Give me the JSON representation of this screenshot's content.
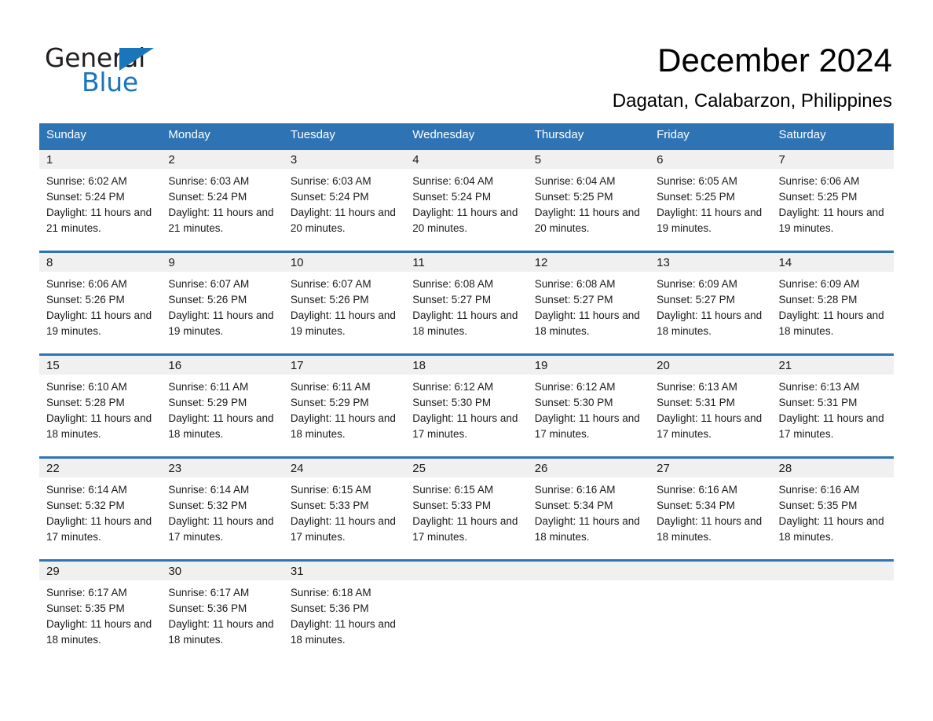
{
  "brand": {
    "name_part1": "General",
    "name_part2": "Blue",
    "logo_icon": "general-blue-triangle-logo",
    "accent_color": "#1b75bb"
  },
  "header": {
    "month_title": "December 2024",
    "location": "Dagatan, Calabarzon, Philippines"
  },
  "colors": {
    "header_blue": "#2e74b5",
    "day_band_gray": "#f0f0f0",
    "text": "#1a1a1a"
  },
  "calendar": {
    "day_headers": [
      "Sunday",
      "Monday",
      "Tuesday",
      "Wednesday",
      "Thursday",
      "Friday",
      "Saturday"
    ],
    "weeks": [
      [
        {
          "day": "1",
          "sunrise": "Sunrise: 6:02 AM",
          "sunset": "Sunset: 5:24 PM",
          "daylight": "Daylight: 11 hours and 21 minutes."
        },
        {
          "day": "2",
          "sunrise": "Sunrise: 6:03 AM",
          "sunset": "Sunset: 5:24 PM",
          "daylight": "Daylight: 11 hours and 21 minutes."
        },
        {
          "day": "3",
          "sunrise": "Sunrise: 6:03 AM",
          "sunset": "Sunset: 5:24 PM",
          "daylight": "Daylight: 11 hours and 20 minutes."
        },
        {
          "day": "4",
          "sunrise": "Sunrise: 6:04 AM",
          "sunset": "Sunset: 5:24 PM",
          "daylight": "Daylight: 11 hours and 20 minutes."
        },
        {
          "day": "5",
          "sunrise": "Sunrise: 6:04 AM",
          "sunset": "Sunset: 5:25 PM",
          "daylight": "Daylight: 11 hours and 20 minutes."
        },
        {
          "day": "6",
          "sunrise": "Sunrise: 6:05 AM",
          "sunset": "Sunset: 5:25 PM",
          "daylight": "Daylight: 11 hours and 19 minutes."
        },
        {
          "day": "7",
          "sunrise": "Sunrise: 6:06 AM",
          "sunset": "Sunset: 5:25 PM",
          "daylight": "Daylight: 11 hours and 19 minutes."
        }
      ],
      [
        {
          "day": "8",
          "sunrise": "Sunrise: 6:06 AM",
          "sunset": "Sunset: 5:26 PM",
          "daylight": "Daylight: 11 hours and 19 minutes."
        },
        {
          "day": "9",
          "sunrise": "Sunrise: 6:07 AM",
          "sunset": "Sunset: 5:26 PM",
          "daylight": "Daylight: 11 hours and 19 minutes."
        },
        {
          "day": "10",
          "sunrise": "Sunrise: 6:07 AM",
          "sunset": "Sunset: 5:26 PM",
          "daylight": "Daylight: 11 hours and 19 minutes."
        },
        {
          "day": "11",
          "sunrise": "Sunrise: 6:08 AM",
          "sunset": "Sunset: 5:27 PM",
          "daylight": "Daylight: 11 hours and 18 minutes."
        },
        {
          "day": "12",
          "sunrise": "Sunrise: 6:08 AM",
          "sunset": "Sunset: 5:27 PM",
          "daylight": "Daylight: 11 hours and 18 minutes."
        },
        {
          "day": "13",
          "sunrise": "Sunrise: 6:09 AM",
          "sunset": "Sunset: 5:27 PM",
          "daylight": "Daylight: 11 hours and 18 minutes."
        },
        {
          "day": "14",
          "sunrise": "Sunrise: 6:09 AM",
          "sunset": "Sunset: 5:28 PM",
          "daylight": "Daylight: 11 hours and 18 minutes."
        }
      ],
      [
        {
          "day": "15",
          "sunrise": "Sunrise: 6:10 AM",
          "sunset": "Sunset: 5:28 PM",
          "daylight": "Daylight: 11 hours and 18 minutes."
        },
        {
          "day": "16",
          "sunrise": "Sunrise: 6:11 AM",
          "sunset": "Sunset: 5:29 PM",
          "daylight": "Daylight: 11 hours and 18 minutes."
        },
        {
          "day": "17",
          "sunrise": "Sunrise: 6:11 AM",
          "sunset": "Sunset: 5:29 PM",
          "daylight": "Daylight: 11 hours and 18 minutes."
        },
        {
          "day": "18",
          "sunrise": "Sunrise: 6:12 AM",
          "sunset": "Sunset: 5:30 PM",
          "daylight": "Daylight: 11 hours and 17 minutes."
        },
        {
          "day": "19",
          "sunrise": "Sunrise: 6:12 AM",
          "sunset": "Sunset: 5:30 PM",
          "daylight": "Daylight: 11 hours and 17 minutes."
        },
        {
          "day": "20",
          "sunrise": "Sunrise: 6:13 AM",
          "sunset": "Sunset: 5:31 PM",
          "daylight": "Daylight: 11 hours and 17 minutes."
        },
        {
          "day": "21",
          "sunrise": "Sunrise: 6:13 AM",
          "sunset": "Sunset: 5:31 PM",
          "daylight": "Daylight: 11 hours and 17 minutes."
        }
      ],
      [
        {
          "day": "22",
          "sunrise": "Sunrise: 6:14 AM",
          "sunset": "Sunset: 5:32 PM",
          "daylight": "Daylight: 11 hours and 17 minutes."
        },
        {
          "day": "23",
          "sunrise": "Sunrise: 6:14 AM",
          "sunset": "Sunset: 5:32 PM",
          "daylight": "Daylight: 11 hours and 17 minutes."
        },
        {
          "day": "24",
          "sunrise": "Sunrise: 6:15 AM",
          "sunset": "Sunset: 5:33 PM",
          "daylight": "Daylight: 11 hours and 17 minutes."
        },
        {
          "day": "25",
          "sunrise": "Sunrise: 6:15 AM",
          "sunset": "Sunset: 5:33 PM",
          "daylight": "Daylight: 11 hours and 17 minutes."
        },
        {
          "day": "26",
          "sunrise": "Sunrise: 6:16 AM",
          "sunset": "Sunset: 5:34 PM",
          "daylight": "Daylight: 11 hours and 18 minutes."
        },
        {
          "day": "27",
          "sunrise": "Sunrise: 6:16 AM",
          "sunset": "Sunset: 5:34 PM",
          "daylight": "Daylight: 11 hours and 18 minutes."
        },
        {
          "day": "28",
          "sunrise": "Sunrise: 6:16 AM",
          "sunset": "Sunset: 5:35 PM",
          "daylight": "Daylight: 11 hours and 18 minutes."
        }
      ],
      [
        {
          "day": "29",
          "sunrise": "Sunrise: 6:17 AM",
          "sunset": "Sunset: 5:35 PM",
          "daylight": "Daylight: 11 hours and 18 minutes."
        },
        {
          "day": "30",
          "sunrise": "Sunrise: 6:17 AM",
          "sunset": "Sunset: 5:36 PM",
          "daylight": "Daylight: 11 hours and 18 minutes."
        },
        {
          "day": "31",
          "sunrise": "Sunrise: 6:18 AM",
          "sunset": "Sunset: 5:36 PM",
          "daylight": "Daylight: 11 hours and 18 minutes."
        },
        {
          "day": "",
          "sunrise": "",
          "sunset": "",
          "daylight": ""
        },
        {
          "day": "",
          "sunrise": "",
          "sunset": "",
          "daylight": ""
        },
        {
          "day": "",
          "sunrise": "",
          "sunset": "",
          "daylight": ""
        },
        {
          "day": "",
          "sunrise": "",
          "sunset": "",
          "daylight": ""
        }
      ]
    ]
  }
}
